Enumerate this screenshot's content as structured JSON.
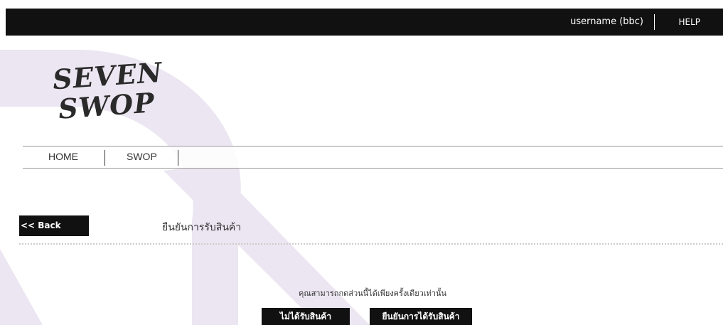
{
  "topbar": {
    "username": "username (bbc)",
    "help": "HELP"
  },
  "logo": {
    "line1": "SEVEN",
    "line2": "SWOP"
  },
  "nav": {
    "items": [
      {
        "label": "HOME"
      },
      {
        "label": "SWOP"
      }
    ]
  },
  "back_button": {
    "label": "<< Back"
  },
  "page": {
    "title": "ยืนยันการรับสินค้า",
    "notice": "คุณสามารถกดส่วนนี้ได้เพียงครั้งเดียวเท่านั้น"
  },
  "actions": {
    "not_received": "ไม่ได้รับสินค้า",
    "confirm_received": "ยืนยันการได้รับสินค้า"
  },
  "colors": {
    "topbar": "#111111",
    "deco": "#ebe6f1",
    "button": "#111111"
  }
}
